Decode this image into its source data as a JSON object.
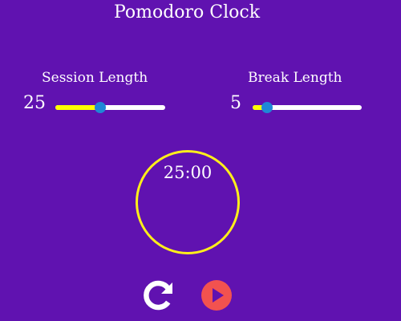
{
  "app": {
    "title": "Pomodoro Clock"
  },
  "session": {
    "label": "Session Length",
    "value": "25",
    "slider_fraction": 0.41
  },
  "break": {
    "label": "Break Length",
    "value": "5",
    "slider_fraction": 0.13
  },
  "timer": {
    "display": "25:00"
  },
  "controls": {
    "reset_icon": "reset-icon",
    "play_icon": "play-icon"
  },
  "colors": {
    "background": "#6012b0",
    "slider_fill": "#ffff00",
    "slider_track": "#ffffff",
    "slider_thumb": "#1e88d6",
    "timer_ring": "#ffef1a",
    "play_button": "#f2524f"
  }
}
